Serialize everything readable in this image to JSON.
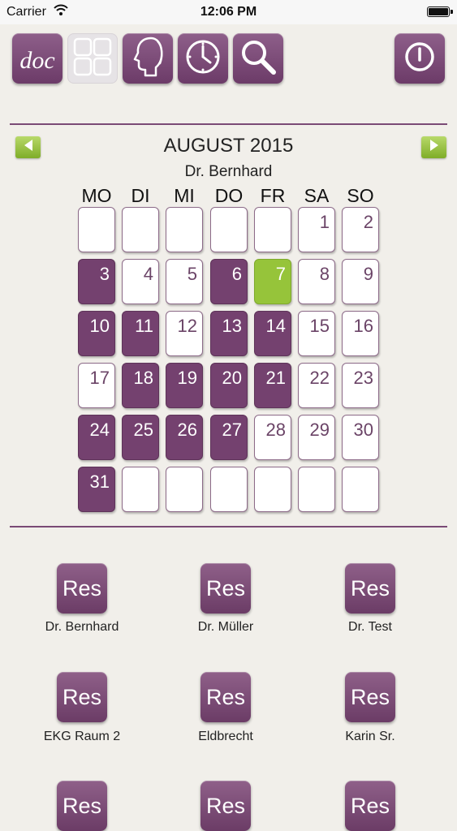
{
  "status_bar": {
    "carrier": "Carrier",
    "time": "12:06 PM"
  },
  "toolbar": {
    "doc_label": "doc",
    "buttons": [
      "doc-button",
      "grid-button",
      "profile-button",
      "clock-button",
      "search-button",
      "power-button"
    ]
  },
  "calendar": {
    "month_title": "AUGUST 2015",
    "doctor": "Dr. Bernhard",
    "weekdays": [
      "MO",
      "DI",
      "MI",
      "DO",
      "FR",
      "SA",
      "SO"
    ],
    "days": [
      "",
      "",
      "",
      "",
      "",
      "1",
      "2",
      "3",
      "4",
      "5",
      "6",
      "7",
      "8",
      "9",
      "10",
      "11",
      "12",
      "13",
      "14",
      "15",
      "16",
      "17",
      "18",
      "19",
      "20",
      "21",
      "22",
      "23",
      "24",
      "25",
      "26",
      "27",
      "28",
      "29",
      "30",
      "31",
      "",
      "",
      "",
      "",
      "",
      ""
    ],
    "booked_days": [
      "3",
      "6",
      "10",
      "11",
      "13",
      "14",
      "18",
      "19",
      "20",
      "21",
      "24",
      "25",
      "26",
      "27",
      "31"
    ],
    "today": "7"
  },
  "resources": [
    {
      "button": "Res",
      "label": "Dr. Bernhard"
    },
    {
      "button": "Res",
      "label": "Dr. Müller"
    },
    {
      "button": "Res",
      "label": "Dr. Test"
    },
    {
      "button": "Res",
      "label": "EKG Raum 2"
    },
    {
      "button": "Res",
      "label": "Eldbrecht"
    },
    {
      "button": "Res",
      "label": "Karin Sr."
    },
    {
      "button": "Res",
      "label": ""
    },
    {
      "button": "Res",
      "label": ""
    },
    {
      "button": "Res",
      "label": ""
    }
  ],
  "colors": {
    "accent_purple": "#74416f",
    "today_green": "#96c43a",
    "background": "#f1efea"
  }
}
